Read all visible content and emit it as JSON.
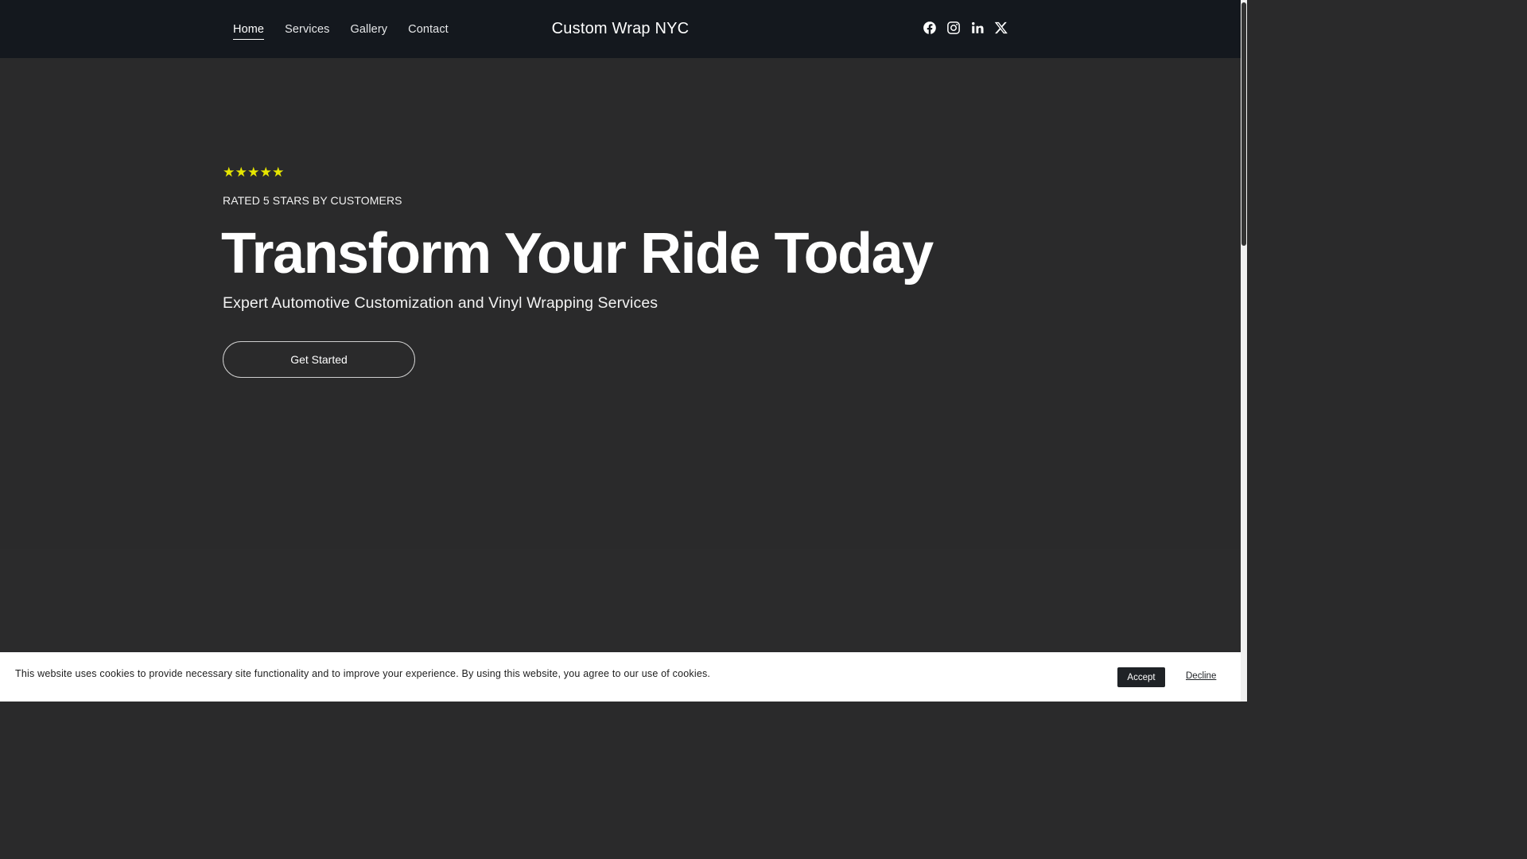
{
  "nav": {
    "links": [
      {
        "label": "Home",
        "active": true
      },
      {
        "label": "Services",
        "active": false
      },
      {
        "label": "Gallery",
        "active": false
      },
      {
        "label": "Contact",
        "active": false
      }
    ],
    "brand": "Custom Wrap NYC",
    "social": [
      "facebook-icon",
      "instagram-icon",
      "linkedin-icon",
      "x-twitter-icon"
    ]
  },
  "hero": {
    "stars": "★★★★★",
    "rating": 5,
    "rated_text": "RATED 5 STARS BY CUSTOMERS",
    "headline": "Transform Your Ride Today",
    "subhead": "Expert Automotive Customization and Vinyl Wrapping Services",
    "cta_label": "Get Started"
  },
  "cookie": {
    "text": "This website uses cookies to provide necessary site functionality and to improve your experience. By using this website, you agree to our use of cookies.",
    "accept_label": "Accept",
    "decline_label": "Decline"
  },
  "colors": {
    "nav_bg": "#14181e",
    "hero_bg": "#2a2a2b",
    "star": "#e6e600",
    "accept_bg": "#1f2226"
  }
}
